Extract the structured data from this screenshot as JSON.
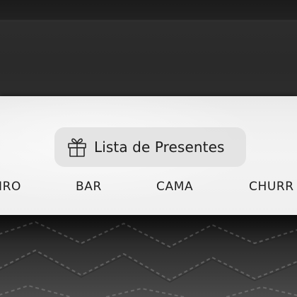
{
  "gift_button": {
    "label": "Lista de Presentes",
    "icon": "gift-icon"
  },
  "categories": [
    {
      "label": "IRO"
    },
    {
      "label": "BAR"
    },
    {
      "label": "CAMA"
    },
    {
      "label": "CHURR"
    }
  ],
  "colors": {
    "header_bg": "#f0f0f0",
    "pill_bg": "#e1e1e1",
    "text": "#1c1c1c",
    "chrome_dark": "#1b1b1b"
  }
}
